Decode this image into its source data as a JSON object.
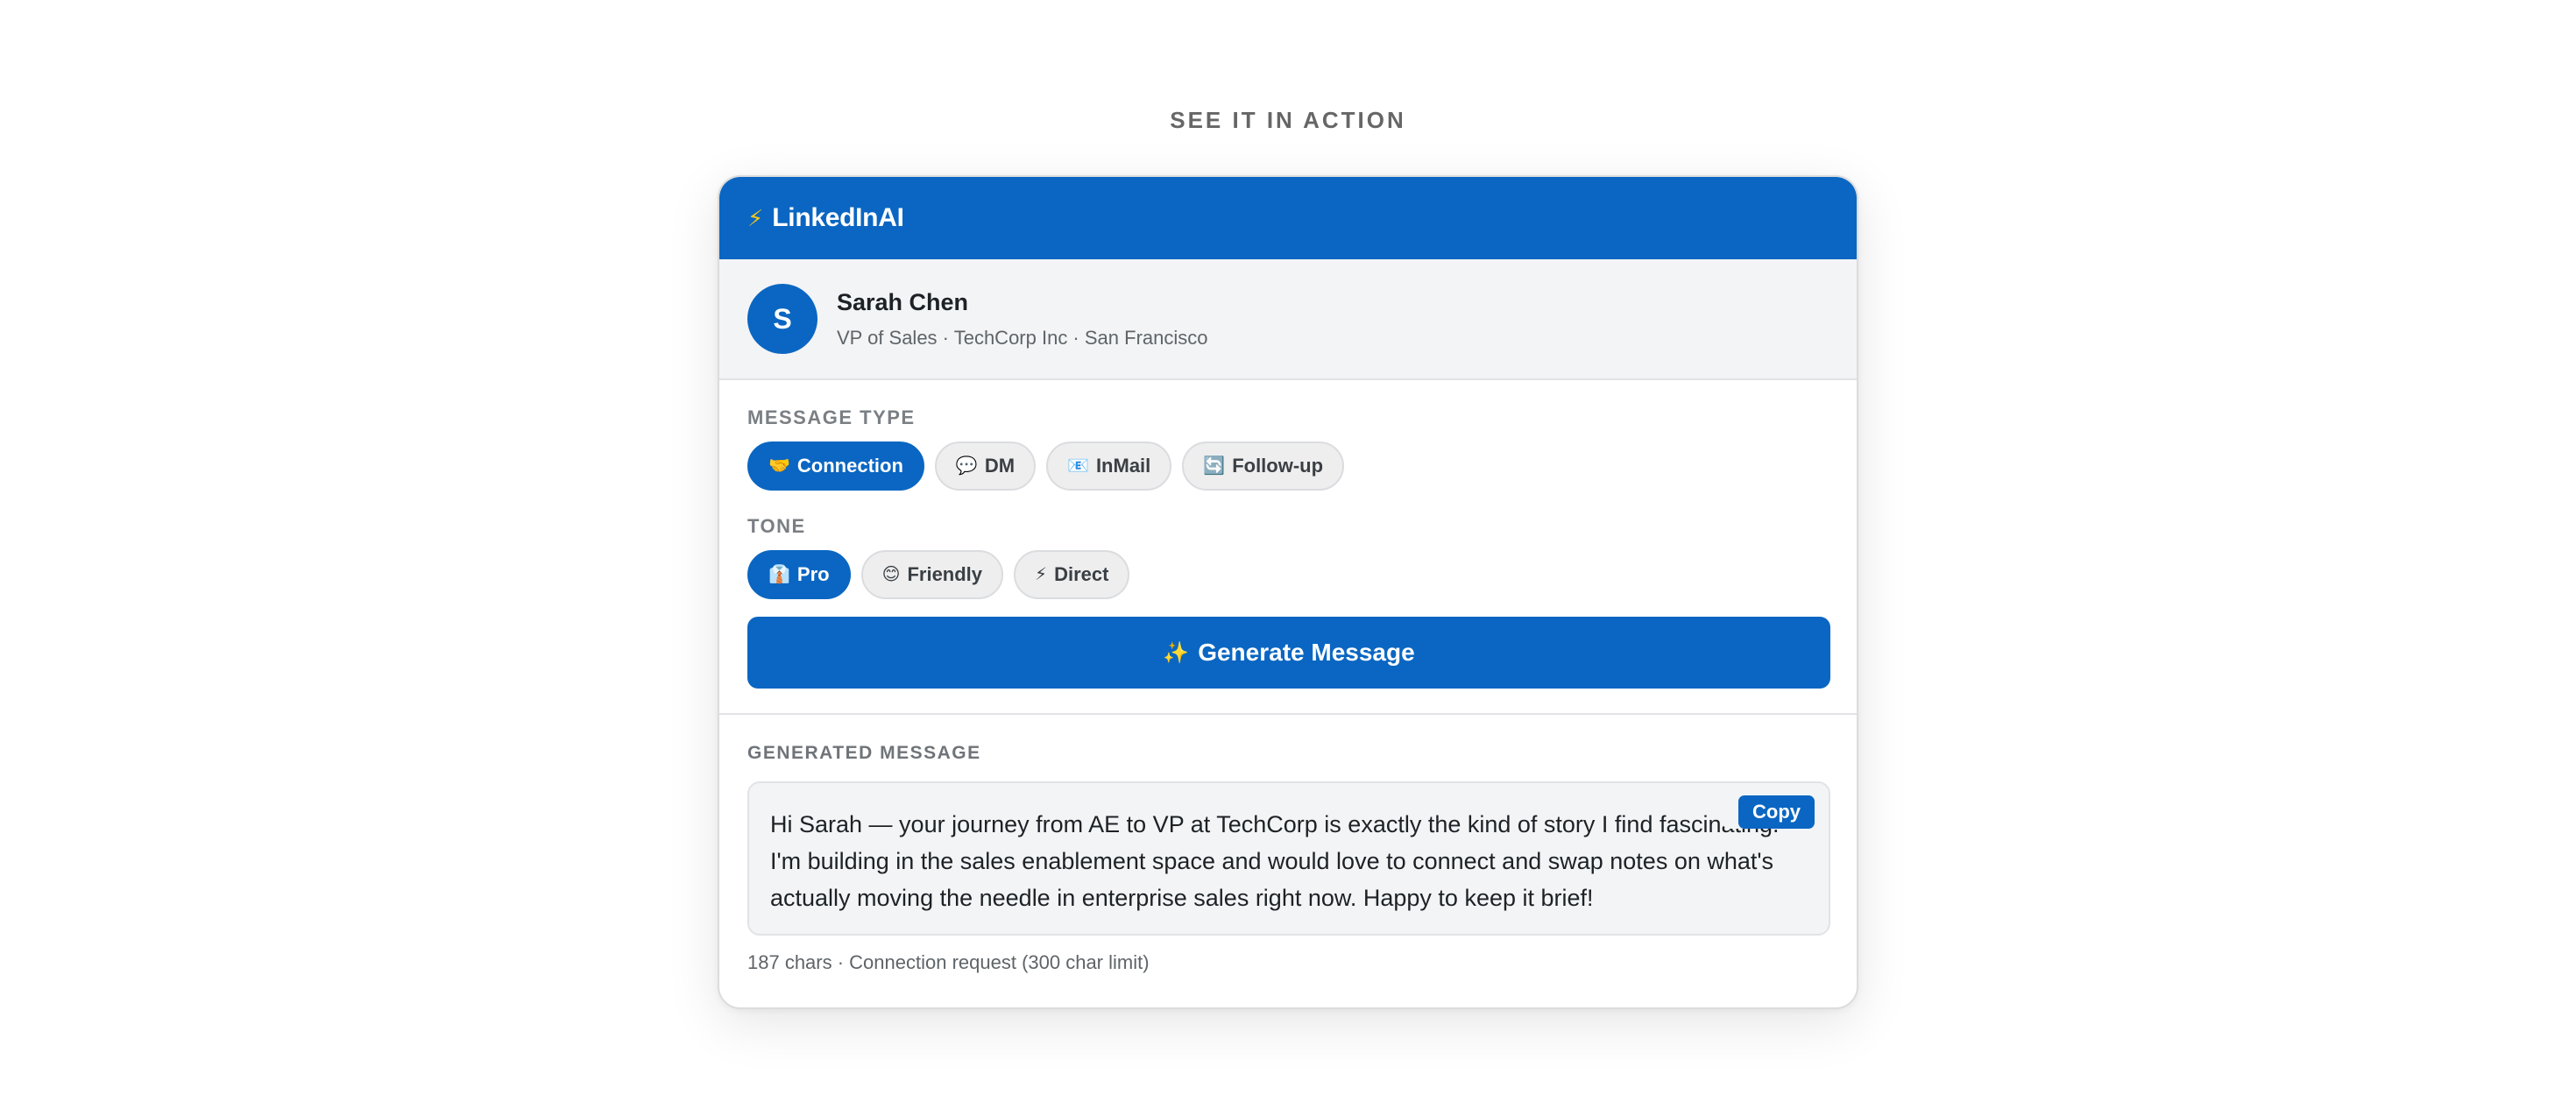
{
  "section": {
    "label": "SEE IT IN ACTION"
  },
  "app": {
    "icon": "bolt-icon",
    "name": "LinkedInAI",
    "accent": "#0a66c2"
  },
  "profile": {
    "initial": "S",
    "name": "Sarah Chen",
    "meta": "VP of Sales · TechCorp Inc · San Francisco"
  },
  "message_type": {
    "label": "MESSAGE TYPE",
    "options": [
      {
        "icon": "🤝",
        "label": "Connection",
        "selected": true
      },
      {
        "icon": "💬",
        "label": "DM",
        "selected": false
      },
      {
        "icon": "📧",
        "label": "InMail",
        "selected": false
      },
      {
        "icon": "🔄",
        "label": "Follow-up",
        "selected": false
      }
    ]
  },
  "tone": {
    "label": "TONE",
    "options": [
      {
        "icon": "👔",
        "label": "Pro",
        "selected": true
      },
      {
        "icon": "😊",
        "label": "Friendly",
        "selected": false
      },
      {
        "icon": "⚡",
        "label": "Direct",
        "selected": false
      }
    ]
  },
  "generate": {
    "icon": "✨",
    "label": "Generate Message"
  },
  "output": {
    "label": "GENERATED MESSAGE",
    "copy_label": "Copy",
    "message": "Hi Sarah — your journey from AE to VP at TechCorp is exactly the kind of story I find fascinating. I'm building in the sales enablement space and would love to connect and swap notes on what's actually moving the needle in enterprise sales right now. Happy to keep it brief!",
    "char_info": "187 chars · Connection request (300 char limit)"
  }
}
